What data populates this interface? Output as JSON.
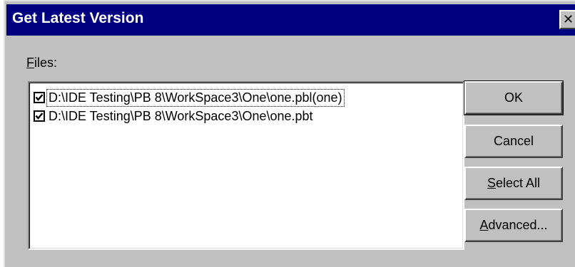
{
  "window": {
    "title": "Get Latest Version",
    "close_glyph": "✕"
  },
  "files_label": {
    "accel": "F",
    "rest": "iles:"
  },
  "files": [
    {
      "path": "D:\\IDE Testing\\PB 8\\WorkSpace3\\One\\one.pbl(one)",
      "checked": true
    },
    {
      "path": "D:\\IDE Testing\\PB 8\\WorkSpace3\\One\\one.pbt",
      "checked": true
    }
  ],
  "buttons": {
    "ok": {
      "label": "OK"
    },
    "cancel": {
      "label": "Cancel"
    },
    "select_all": {
      "accel": "S",
      "rest": "elect All"
    },
    "advanced": {
      "accel": "A",
      "rest": "dvanced..."
    }
  },
  "icons": {
    "close": "close-icon",
    "checkbox": "checkmark-icon"
  },
  "colors": {
    "titlebar": "#000080",
    "dialog_face": "#c0c0c0",
    "list_background": "#ffffff"
  }
}
